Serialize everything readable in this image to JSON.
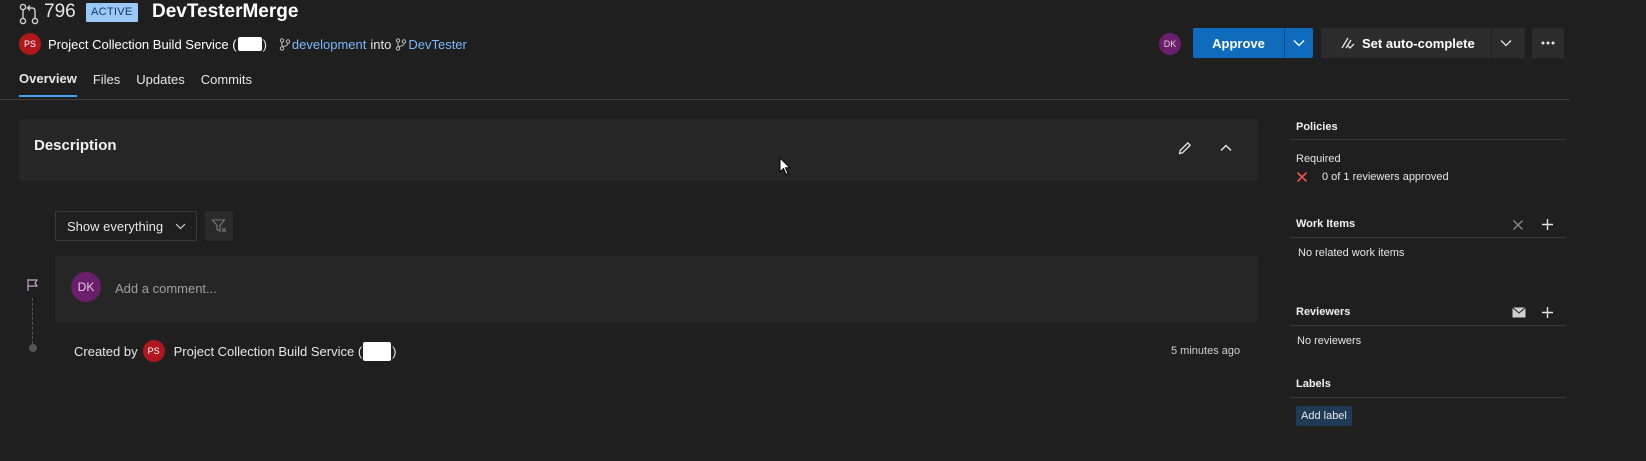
{
  "pr": {
    "number": "796",
    "status": "ACTIVE",
    "title": "DevTesterMerge",
    "author_initials": "PS",
    "author_name": "Project Collection Build Service (",
    "author_suffix": ")",
    "source_branch": "development",
    "into_text": "into",
    "target_branch": "DevTester"
  },
  "tabs": [
    "Overview",
    "Files",
    "Updates",
    "Commits"
  ],
  "actions": {
    "reviewer_initials": "DK",
    "approve_label": "Approve",
    "autocomplete_label": "Set auto-complete"
  },
  "description": {
    "title": "Description"
  },
  "activity": {
    "filter_label": "Show everything",
    "comment_avatar": "DK",
    "comment_placeholder": "Add a comment...",
    "created_by_label": "Created by",
    "created_by_initials": "PS",
    "created_by_name": "Project Collection Build Service (",
    "created_by_suffix": ")",
    "created_time": "5 minutes ago"
  },
  "sidebar": {
    "policies_title": "Policies",
    "required_label": "Required",
    "policy_status": "0 of 1 reviewers approved",
    "work_items_title": "Work Items",
    "work_items_empty": "No related work items",
    "reviewers_title": "Reviewers",
    "reviewers_empty": "No reviewers",
    "labels_title": "Labels",
    "add_label": "Add label"
  },
  "colors": {
    "accent": "#0f6cbd",
    "link": "#7cb6ff",
    "error": "#e5534b",
    "badge_active": "#9cc8f5"
  }
}
